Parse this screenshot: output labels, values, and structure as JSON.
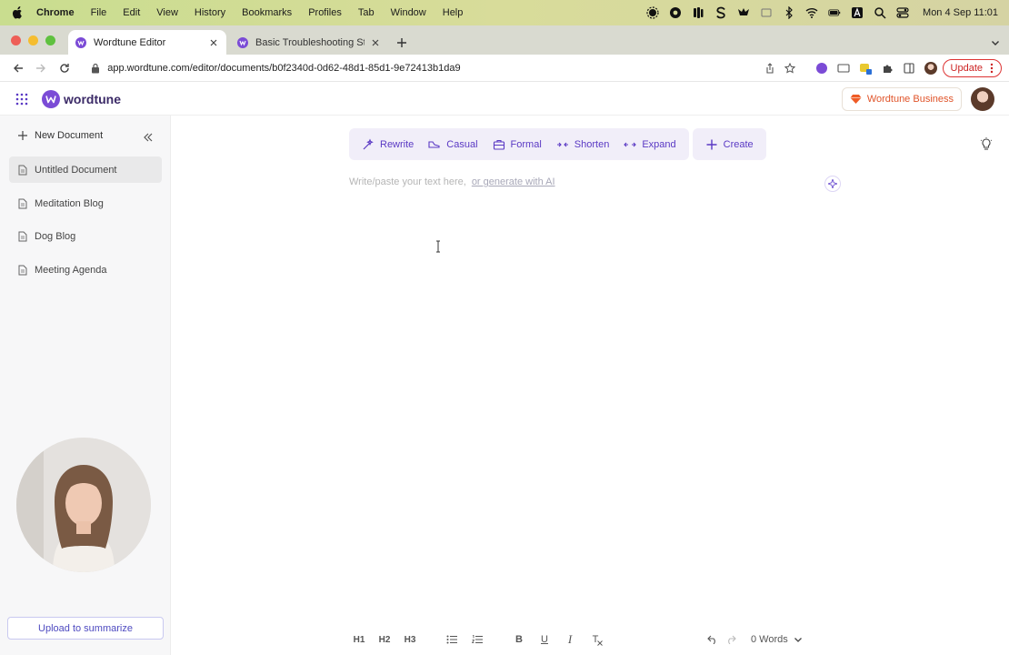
{
  "menubar": {
    "app": "Chrome",
    "items": [
      "File",
      "Edit",
      "View",
      "History",
      "Bookmarks",
      "Profiles",
      "Tab",
      "Window",
      "Help"
    ],
    "clock": "Mon 4 Sep  11:01"
  },
  "tabs": [
    {
      "label": "Wordtune Editor",
      "active": true
    },
    {
      "label": "Basic Troubleshooting Steps |",
      "active": false
    }
  ],
  "address": {
    "url": "app.wordtune.com/editor/documents/b0f2340d-0d62-48d1-85d1-9e72413b1da9",
    "update_label": "Update"
  },
  "header": {
    "logo_text": "wordtune",
    "business_label": "Wordtune Business"
  },
  "sidebar": {
    "new_document_label": "New Document",
    "documents": [
      {
        "label": "Untitled Document",
        "active": true
      },
      {
        "label": "Meditation Blog",
        "active": false
      },
      {
        "label": "Dog Blog",
        "active": false
      },
      {
        "label": "Meeting Agenda",
        "active": false
      }
    ],
    "upload_label": "Upload to summarize"
  },
  "editor": {
    "actions": [
      {
        "label": "Rewrite",
        "icon": "sparkle-pen-icon"
      },
      {
        "label": "Casual",
        "icon": "sneaker-icon"
      },
      {
        "label": "Formal",
        "icon": "briefcase-icon"
      },
      {
        "label": "Shorten",
        "icon": "shrink-arrows-icon"
      },
      {
        "label": "Expand",
        "icon": "expand-arrows-icon"
      }
    ],
    "create_label": "Create",
    "placeholder": "Write/paste your text here,",
    "generate_link": "or generate with AI",
    "format": {
      "h1": "H1",
      "h2": "H2",
      "h3": "H3",
      "bold": "B",
      "underline": "U",
      "italic": "I",
      "clear": "T"
    },
    "word_count": "0 Words"
  },
  "colors": {
    "accent": "#5a39c4",
    "action_bg": "#f1eef9",
    "business": "#e0542a",
    "update": "#cc2222"
  }
}
